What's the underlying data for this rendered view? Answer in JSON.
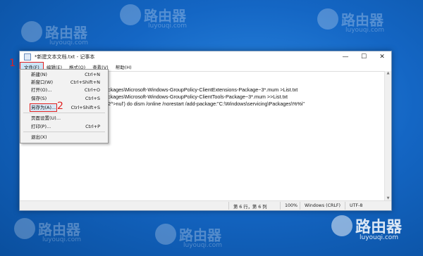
{
  "watermark": {
    "brand": "路由器",
    "site": "luyouqi.com"
  },
  "window": {
    "title": "*新建文本文档.txt - 记事本",
    "controls": {
      "minimize": "—",
      "maximize": "☐",
      "close": "✕"
    }
  },
  "menubar": [
    {
      "label": "文件(F)"
    },
    {
      "label": "编辑(E)"
    },
    {
      "label": "格式(O)"
    },
    {
      "label": "查看(V)"
    },
    {
      "label": "帮助(H)"
    }
  ],
  "editor": {
    "lines": [
      "ackages\\Microsoft-Windows-GroupPolicy-ClientExtensions-Package~3*.mum >List.txt",
      "ackages\\Microsoft-Windows-GroupPolicy-ClientTools-Package~3*.mum >>List.txt",
      "t 2^>nul') do dism /online /norestart /add-package:\"C:\\Windows\\servicing\\Packages\\%%i\""
    ]
  },
  "file_menu": {
    "items": [
      {
        "label": "新建(N)",
        "shortcut": "Ctrl+N"
      },
      {
        "label": "新窗口(W)",
        "shortcut": "Ctrl+Shift+N"
      },
      {
        "label": "打开(O)...",
        "shortcut": "Ctrl+O"
      },
      {
        "label": "保存(S)",
        "shortcut": "Ctrl+S"
      },
      {
        "label": "另存为(A)...",
        "shortcut": "Ctrl+Shift+S"
      },
      {
        "label": "页面设置(U)...",
        "shortcut": ""
      },
      {
        "label": "打印(P)...",
        "shortcut": "Ctrl+P"
      },
      {
        "label": "退出(X)",
        "shortcut": ""
      }
    ]
  },
  "statusbar": {
    "position": "第 6 行，第 6 列",
    "zoom": "100%",
    "line_ending": "Windows (CRLF)",
    "encoding": "UTF-8"
  },
  "callouts": {
    "step1": "1",
    "step2": "2"
  },
  "colors": {
    "highlight": "#e02020",
    "desktop": "#1466c4"
  }
}
